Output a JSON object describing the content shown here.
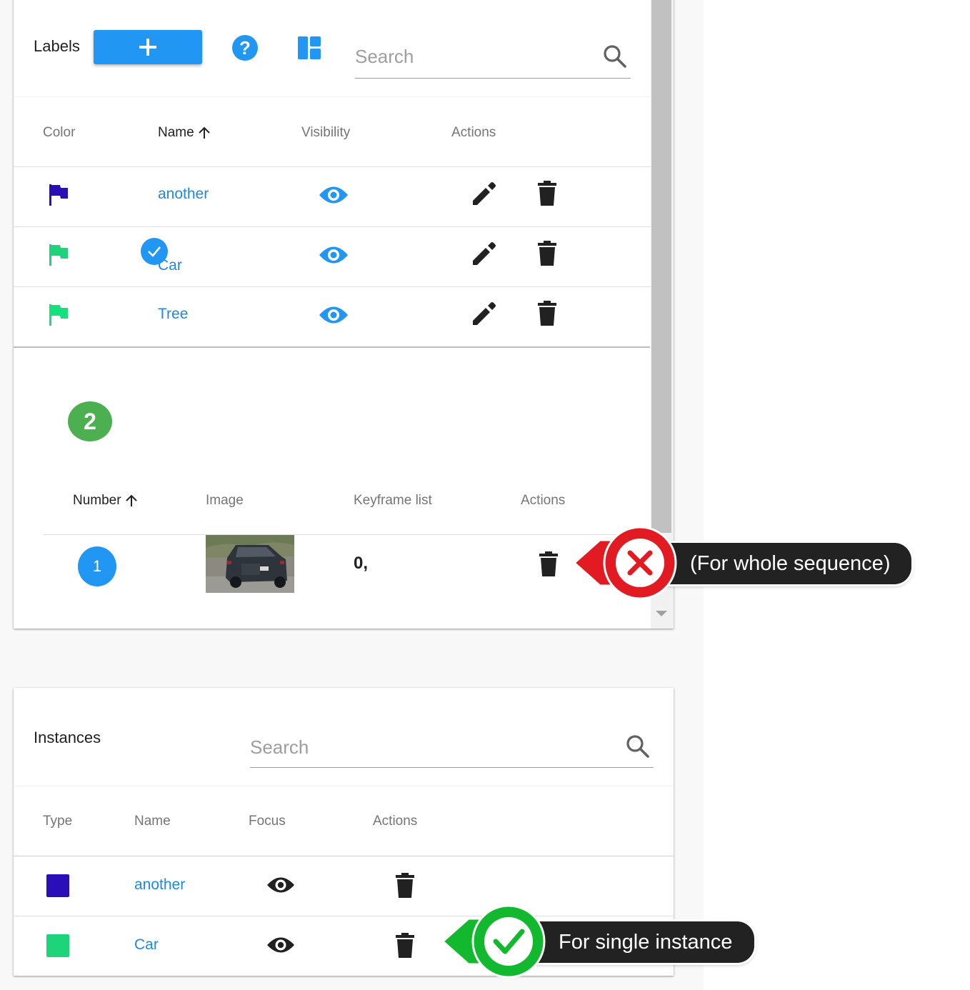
{
  "labels_panel": {
    "title": "Labels",
    "add_button_icon": "plus-icon",
    "help_icon": "help-circle-icon",
    "layout_icon": "layout-icon",
    "search_placeholder": "Search",
    "columns": {
      "color": "Color",
      "name": "Name",
      "visibility": "Visibility",
      "actions": "Actions"
    },
    "sort_icon": "arrow-up-icon",
    "rows": [
      {
        "name": "another",
        "color": "#2a0fb8",
        "selected": false
      },
      {
        "name": "Car",
        "color": "#1ed47a",
        "selected": true
      },
      {
        "name": "Tree",
        "color": "#14e07c",
        "selected": false
      }
    ]
  },
  "step_badge": {
    "number": "2",
    "color": "#4caf50"
  },
  "sequence_table": {
    "columns": {
      "number": "Number",
      "image": "Image",
      "keyframes": "Keyframe list",
      "actions": "Actions"
    },
    "rows": [
      {
        "number": "1",
        "keyframes": "0,"
      }
    ]
  },
  "instances_panel": {
    "title": "Instances",
    "search_placeholder": "Search",
    "columns": {
      "type": "Type",
      "name": "Name",
      "focus": "Focus",
      "actions": "Actions"
    },
    "rows": [
      {
        "name": "another",
        "color": "#2a0fb8"
      },
      {
        "name": "Car",
        "color": "#1ed47a"
      }
    ]
  },
  "callouts": {
    "wrong": {
      "text": "(For whole sequence)",
      "color": "#e21b23",
      "icon": "x-mark-icon"
    },
    "right": {
      "text": "For single instance",
      "color": "#12b82e",
      "icon": "check-mark-icon"
    }
  },
  "colors": {
    "accent_blue": "#2196f3",
    "link_blue": "#1e88e5"
  }
}
